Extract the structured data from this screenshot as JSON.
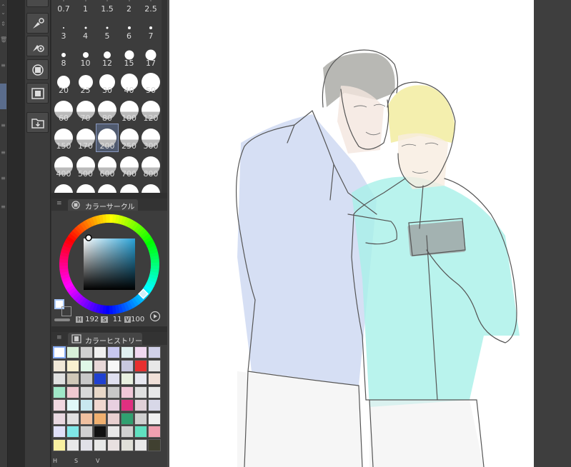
{
  "brush_sizes": {
    "rows": [
      {
        "labels": [
          "0.7",
          "1",
          "1.5",
          "2",
          "2.5"
        ],
        "dot": [
          1,
          1,
          1,
          1,
          1
        ]
      },
      {
        "labels": [
          "3",
          "4",
          "5",
          "6",
          "7"
        ],
        "dot": [
          2,
          3,
          3,
          4,
          4
        ]
      },
      {
        "labels": [
          "8",
          "10",
          "12",
          "15",
          "17"
        ],
        "dot": [
          6,
          8,
          10,
          13,
          15
        ]
      },
      {
        "labels": [
          "20",
          "25",
          "30",
          "40",
          "50"
        ],
        "dot": [
          18,
          20,
          22,
          24,
          26
        ]
      },
      {
        "labels": [
          "60",
          "70",
          "80",
          "100",
          "120"
        ],
        "dot": [
          26,
          26,
          26,
          26,
          26
        ]
      },
      {
        "labels": [
          "150",
          "170",
          "200",
          "250",
          "300"
        ],
        "dot": [
          26,
          26,
          26,
          26,
          26
        ]
      },
      {
        "labels": [
          "400",
          "500",
          "600",
          "700",
          "800"
        ],
        "dot": [
          26,
          26,
          26,
          26,
          26
        ]
      }
    ],
    "selected": "200"
  },
  "color_circle": {
    "title": "カラーサークル",
    "h_label": "H",
    "h_value": "192",
    "s_label": "S",
    "s_value": "11",
    "v_label": "V",
    "v_value": "100"
  },
  "color_history": {
    "title": "カラーヒストリー",
    "footer": [
      "H",
      "S",
      "V"
    ],
    "swatches": [
      "#ffffff",
      "#d8f0d8",
      "#d0d0d0",
      "#f0f0f0",
      "#c8c8f0",
      "#e0f0f0",
      "#f0d8f0",
      "#d0d0e8",
      "#f0e8d8",
      "#f8f0d0",
      "#e0f8e8",
      "#e8d8d8",
      "#f8f8f8",
      "#c8c8e0",
      "#e83030",
      "#e8e8e8",
      "#e0e0e0",
      "#d0c8b8",
      "#c8c8c8",
      "#2040d0",
      "#e0e0f0",
      "#e8f0e0",
      "#e8e8f0",
      "#f0e0d8",
      "#a0e8c8",
      "#f0c8d0",
      "#d8d8d8",
      "#e8d8c8",
      "#c8c8c8",
      "#f0c8d8",
      "#e0e0e0",
      "#e8e8e8",
      "#f0d8e0",
      "#e0f8f8",
      "#c8e8f0",
      "#f0d8d0",
      "#e8d0e0",
      "#e03080",
      "#e0d0d8",
      "#d8d8e8",
      "#e8d8e0",
      "#e0e0e0",
      "#f0c0a0",
      "#f0b070",
      "#e8d0d0",
      "#30a070",
      "#d0d0d0",
      "#f0f0f0",
      "#e0e0f8",
      "#80e8e8",
      "#d0d0d0",
      "#101010",
      "#e8e8e8",
      "#d0d0d0",
      "#60e0c0",
      "#f0a0b0",
      "#f8f0a0",
      "#e8e8e8",
      "#e0e0e8",
      "#e8e8e8",
      "#e8e0e0",
      "#e0e0d8",
      "#e8e8e8",
      "#404030"
    ]
  },
  "icons": [
    "brush-settings-icon",
    "brush-target-icon",
    "layer-icon",
    "filmstrip-icon",
    "import-folder-icon",
    "menu-icon"
  ],
  "colors": {
    "panel_bg": "#3c3c3c",
    "selection": "#5a6c8c",
    "canvas": "#ffffff"
  }
}
